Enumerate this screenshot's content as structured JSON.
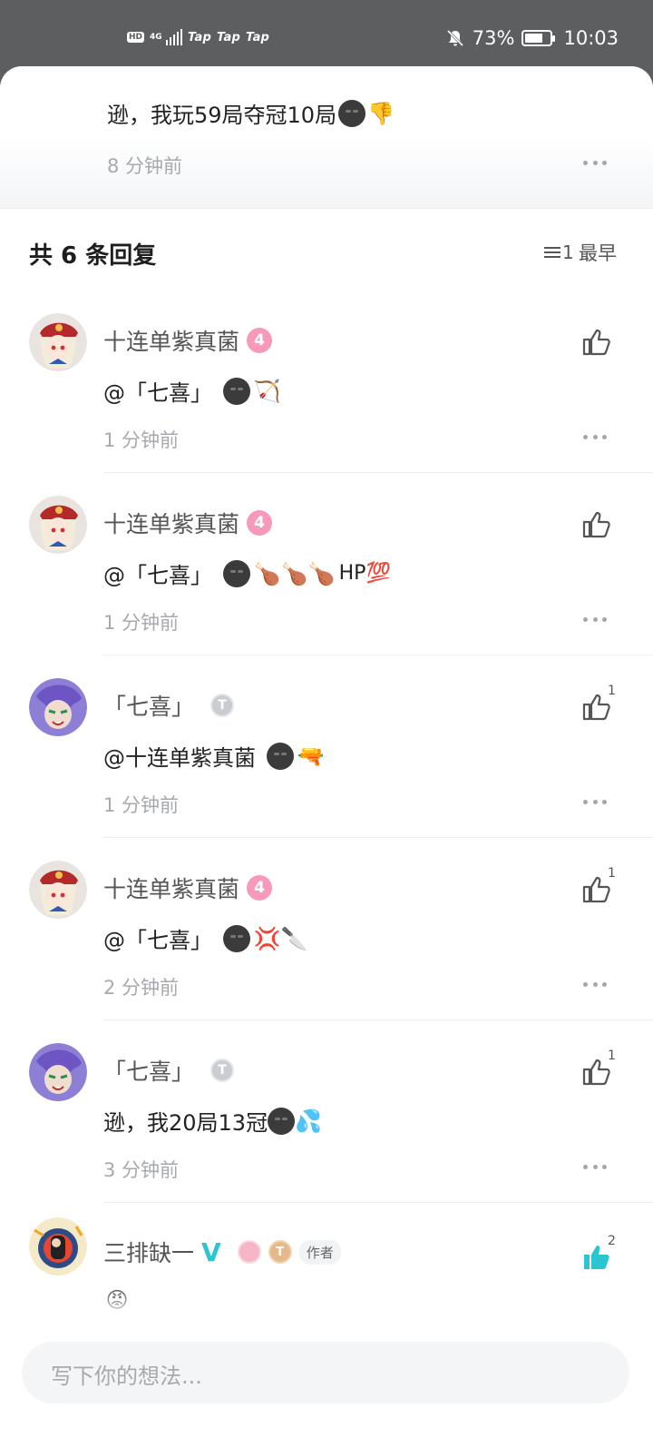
{
  "status_bar": {
    "hd": "HD",
    "network": "4G",
    "carrier_tags": [
      "Tap",
      "Tap",
      "Tap"
    ],
    "battery_percent": "73%",
    "battery_level": 0.73,
    "time": "10:03"
  },
  "parent_comment": {
    "text": "逊，我玩59局夺冠10局",
    "emoji": "👎",
    "time": "8 分钟前"
  },
  "replies_header": {
    "title": "共 6 条回复",
    "sort_label": "最早"
  },
  "replies": [
    {
      "user": "十连单紫真菌",
      "level": "4",
      "content": "@「七喜」 ",
      "emojis": [
        "🏹"
      ],
      "suffix": "",
      "time": "1 分钟前",
      "likes": ""
    },
    {
      "user": "十连单紫真菌",
      "level": "4",
      "content": "@「七喜」 ",
      "emojis": [
        "🍗",
        "🍗",
        "🍗"
      ],
      "suffix": "HP💯",
      "time": "1 分钟前",
      "likes": ""
    },
    {
      "user": "「七喜」",
      "level": "T",
      "content": "@十连单紫真菌 ",
      "emojis": [
        "🔫"
      ],
      "suffix": "",
      "time": "1 分钟前",
      "likes": "1"
    },
    {
      "user": "十连单紫真菌",
      "level": "4",
      "content": "@「七喜」 ",
      "emojis": [
        "💢",
        "🔪"
      ],
      "suffix": "",
      "time": "2 分钟前",
      "likes": "1"
    },
    {
      "user": "「七喜」",
      "level": "T",
      "content": "逊，我20局13冠",
      "emojis": [
        "💦"
      ],
      "suffix": "",
      "time": "3 分钟前",
      "likes": "1"
    }
  ],
  "author_reply": {
    "user": "三排缺一",
    "verified": "V",
    "gold_badge": "T",
    "tag": "作者",
    "emoji": "😡",
    "likes": "2"
  },
  "composer": {
    "placeholder": "写下你的想法..."
  },
  "colors": {
    "accent": "#2bc4d1",
    "level_pink": "#f79ab9",
    "muted_text": "#a6a9ad"
  }
}
